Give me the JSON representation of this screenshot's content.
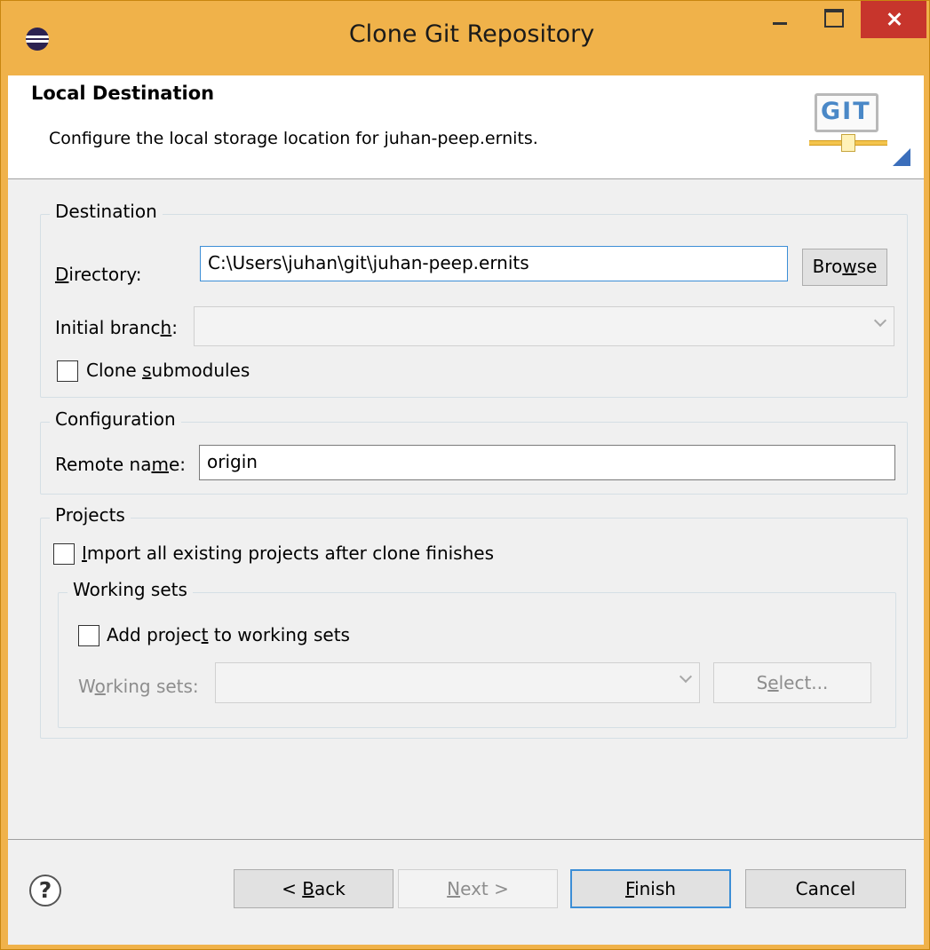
{
  "window": {
    "title": "Clone Git Repository"
  },
  "header": {
    "title": "Local Destination",
    "description": "Configure the local storage location for juhan-peep.ernits.",
    "logo_text": "GIT"
  },
  "destination": {
    "group_label": "Destination",
    "directory_label": "Directory:",
    "directory_value": "C:\\Users\\juhan\\git\\juhan-peep.ernits",
    "browse_label": "Browse",
    "initial_branch_label": "Initial branch:",
    "initial_branch_value": "",
    "clone_submodules_label": "Clone submodules",
    "clone_submodules_checked": false
  },
  "configuration": {
    "group_label": "Configuration",
    "remote_name_label": "Remote name:",
    "remote_name_value": "origin"
  },
  "projects": {
    "group_label": "Projects",
    "import_label": "Import all existing projects after clone finishes",
    "import_checked": false,
    "working_sets": {
      "group_label": "Working sets",
      "add_label": "Add project to working sets",
      "add_checked": false,
      "sets_label": "Working sets:",
      "sets_value": "",
      "select_label": "Select..."
    }
  },
  "footer": {
    "help_symbol": "?",
    "back_label": "< Back",
    "next_label": "Next >",
    "finish_label": "Finish",
    "cancel_label": "Cancel"
  },
  "colors": {
    "title_bar": "#f0b24a",
    "close_button": "#c7352c",
    "focus_border": "#3c8ed6",
    "dialog_bg": "#f0f0f0"
  }
}
